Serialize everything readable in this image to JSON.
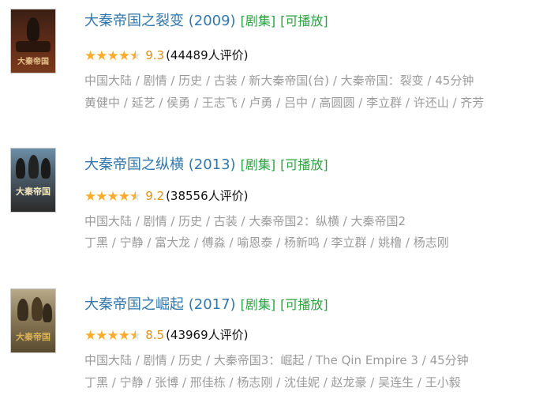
{
  "items": [
    {
      "title": "大秦帝国之裂变 (2009)",
      "tags": [
        "[剧集]",
        "[可播放]"
      ],
      "score": "9.3",
      "rating_count": "(44489人评价)",
      "stars": 4.5,
      "meta_line": "中国大陆 / 剧情 / 历史 / 古装 / 新大秦帝国(台) / 大秦帝国：裂变 / 45分钟",
      "cast_line": "黄健中 / 延艺 / 侯勇 / 王志飞 / 卢勇 / 吕中 / 高圆圆 / 李立群 / 许还山 / 齐芳",
      "poster_caption": "大秦帝国",
      "poster_colors": {
        "sky": "#3a1f14",
        "ground": "#7a3a1c",
        "caption": "#e8c08a"
      }
    },
    {
      "title": "大秦帝国之纵横 (2013)",
      "tags": [
        "[剧集]",
        "[可播放]"
      ],
      "score": "9.2",
      "rating_count": "(38556人评价)",
      "stars": 4.5,
      "meta_line": "中国大陆 / 剧情 / 历史 / 古装 / 大秦帝国2：纵横 / 大秦帝国2",
      "cast_line": "丁黑 / 宁静 / 富大龙 / 傅淼 / 喻恩泰 / 杨新鸣 / 李立群 / 姚橹 / 杨志刚",
      "poster_caption": "大秦帝国",
      "poster_colors": {
        "sky": "#6b8fa8",
        "ground": "#2a2a2a",
        "caption": "#f2e6c0"
      }
    },
    {
      "title": "大秦帝国之崛起 (2017)",
      "tags": [
        "[剧集]",
        "[可播放]"
      ],
      "score": "8.5",
      "rating_count": "(43969人评价)",
      "stars": 4.5,
      "meta_line": "中国大陆 / 剧情 / 历史 / 大秦帝国3：崛起 / The Qin Empire 3 / 45分钟",
      "cast_line": "丁黑 / 宁静 / 张博 / 邢佳栋 / 杨志刚 / 沈佳妮 / 赵龙豪 / 吴连生 / 王小毅",
      "poster_caption": "大秦帝国",
      "poster_colors": {
        "sky": "#b8ab8a",
        "ground": "#5a4a2e",
        "caption": "#d9b35a"
      }
    }
  ]
}
